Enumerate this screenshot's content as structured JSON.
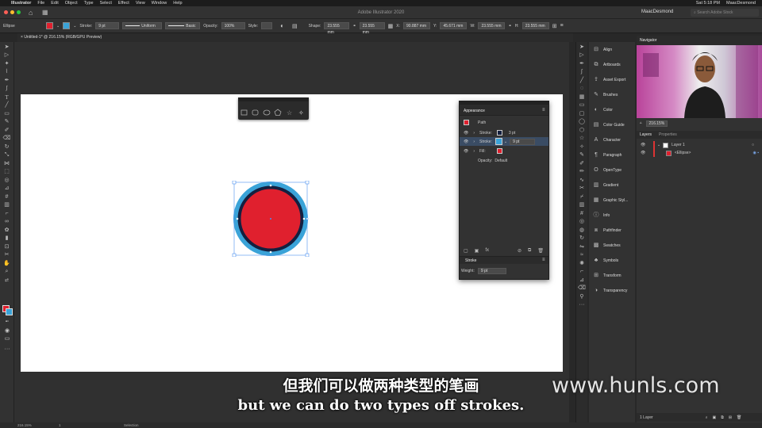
{
  "menubar": {
    "app": "Illustrator",
    "items": [
      "File",
      "Edit",
      "Object",
      "Type",
      "Select",
      "Effect",
      "View",
      "Window",
      "Help"
    ],
    "clock": "Sat 5:18 PM",
    "user": "MaacDesmond"
  },
  "titlebar": {
    "title": "Adobe Illustrator 2020",
    "workspace": "MaacDesmond",
    "search_placeholder": "Search Adobe Stock"
  },
  "control": {
    "selection": "Ellipse",
    "stroke_label": "Stroke:",
    "stroke_value": "9 pt",
    "profile": "Uniform",
    "brush": "Basic",
    "opacity_label": "Opacity:",
    "opacity_value": "100%",
    "style_label": "Style:",
    "shape_label": "Shape:",
    "w1": "23.555 mm",
    "w2": "23.555 mm",
    "x": "90.887 mm",
    "y": "45.671 mm",
    "w": "23.555 mm",
    "h": "23.555 mm",
    "fill_color": "#e0202e",
    "stroke_color": "#3aa3d8"
  },
  "doc_tab": "Untitled-1* @ 216.15% (RGB/GPU Preview)",
  "appearance": {
    "title": "Appearance",
    "object": "Path",
    "rows": [
      {
        "label": "Stroke:",
        "value": "3 pt"
      },
      {
        "label": "Stroke:",
        "value": "9 pt"
      },
      {
        "label": "Fill:",
        "value": ""
      },
      {
        "label": "Opacity:",
        "value": "Default"
      }
    ],
    "stroke_panel_title": "Stroke",
    "weight_label": "Weight:",
    "weight_value": "9 pt"
  },
  "panels": [
    "Align",
    "Artboards",
    "Asset Export",
    "Brushes",
    "Color",
    "Color Guide",
    "Character",
    "Paragraph",
    "OpenType",
    "Gradient",
    "Graphic Styl...",
    "Info",
    "Pathfinder",
    "Swatches",
    "Symbols",
    "Transform",
    "Transparency"
  ],
  "navigator": {
    "title": "Navigator",
    "zoom": "216.15%"
  },
  "layers": {
    "tabs": [
      "Layers",
      "Properties"
    ],
    "items": [
      {
        "name": "Layer 1"
      },
      {
        "name": "<Ellipse>"
      }
    ],
    "footer": "1 Layer"
  },
  "status": {
    "zoom": "216.15%",
    "tool": "Selection",
    "page": "1"
  },
  "subtitles": {
    "cn": "但我们可以做两种类型的笔画",
    "en": "but we can do two types off strokes."
  },
  "watermark": "www.hunls.com"
}
